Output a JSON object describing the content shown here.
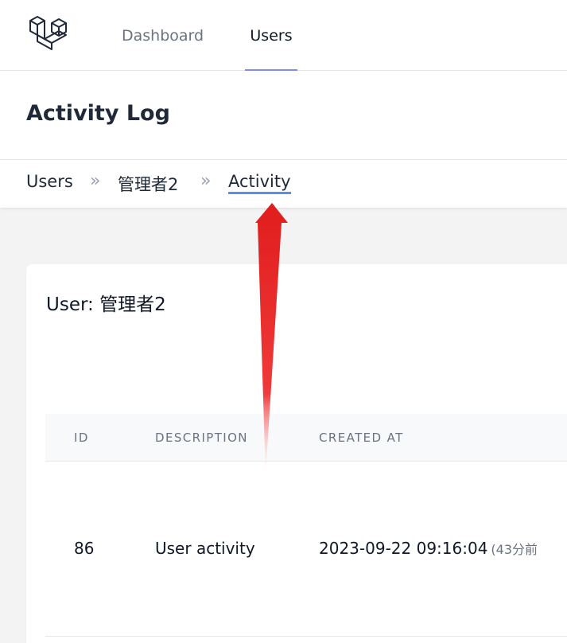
{
  "nav": {
    "logo_icon": "laravel-logo-icon",
    "links": [
      {
        "label": "Dashboard",
        "active": false
      },
      {
        "label": "Users",
        "active": true
      }
    ]
  },
  "header": {
    "title": "Activity Log"
  },
  "breadcrumb": {
    "items": [
      "Users",
      "管理者2",
      "Activity"
    ],
    "separator": "»"
  },
  "card": {
    "title": "User: 管理者2",
    "table": {
      "columns": [
        "ID",
        "DESCRIPTION",
        "CREATED AT"
      ],
      "rows": [
        {
          "id": "86",
          "description": "User activity",
          "created_at": "2023-09-22 09:16:04",
          "relative": "(43分前"
        }
      ]
    }
  },
  "annotation": {
    "arrow_color": "#e11d1d",
    "points_to": "breadcrumb Activity"
  },
  "colors": {
    "active_underline": "#818cf8",
    "breadcrumb_underline": "#5b8def"
  }
}
